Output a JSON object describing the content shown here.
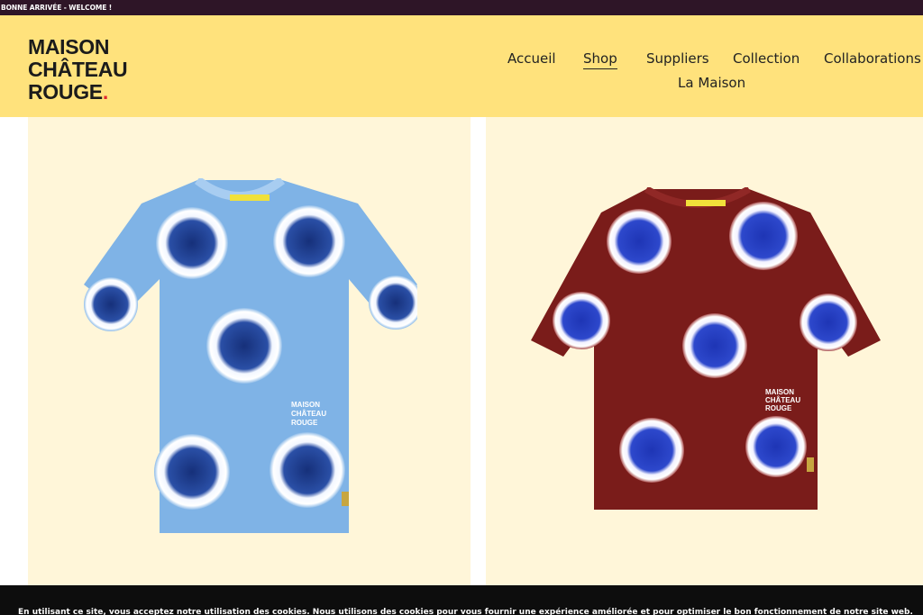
{
  "announcement": "BONNE ARRIVÉE - WELCOME !",
  "logo": {
    "line1": "MAISON",
    "line2": "CHÂTEAU",
    "line3": "ROUGE",
    "dot": "."
  },
  "nav": {
    "accueil": "Accueil",
    "shop": "Shop",
    "suppliers": "Suppliers",
    "collection": "Collection",
    "collaborations": "Collaborations",
    "la_maison": "La Maison"
  },
  "products": [
    {
      "color_name": "blue",
      "body_color": "#7fb3e6",
      "dot_color": "#1a3c8e",
      "brand_print": [
        "MAISON",
        "CHÂTEAU",
        "ROUGE"
      ],
      "label": "MAISON CHÂTEAU ROUGE"
    },
    {
      "color_name": "maroon",
      "body_color": "#7a1c1a",
      "dot_color": "#2a3fb8",
      "brand_print": [
        "MAISON",
        "CHÂTEAU",
        "ROUGE"
      ],
      "label": "MAISON CHÂTEAU ROUGE"
    }
  ],
  "cookie_text": "En utilisant ce site, vous acceptez notre utilisation des cookies. Nous utilisons des cookies pour vous fournir une expérience améliorée et pour optimiser le bon fonctionnement de notre site web.",
  "colors": {
    "accent_yellow": "#ffe27c",
    "cream": "#fff6d9",
    "dark_bar": "#2e1527",
    "logo_dot": "#e0252f"
  }
}
